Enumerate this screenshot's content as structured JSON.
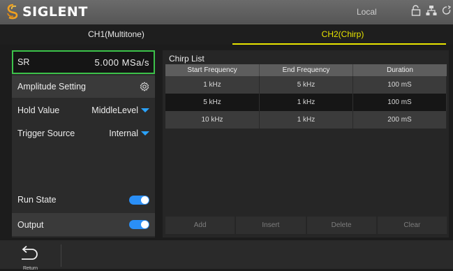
{
  "header": {
    "brand": "SIGLENT",
    "status_text": "Local",
    "icons": [
      "unlock-icon",
      "network-icon",
      "refresh-icon"
    ]
  },
  "tabs": [
    {
      "label": "CH1(Multitone)",
      "active": false
    },
    {
      "label": "CH2(Chirp)",
      "active": true
    }
  ],
  "settings": {
    "sr": {
      "label": "SR",
      "value": "5.000 MSa/s"
    },
    "amplitude": {
      "label": "Amplitude Setting"
    },
    "hold_value": {
      "label": "Hold Value",
      "value": "MiddleLevel"
    },
    "trigger_source": {
      "label": "Trigger Source",
      "value": "Internal"
    },
    "run_state": {
      "label": "Run State",
      "on": true
    },
    "output": {
      "label": "Output",
      "on": true
    }
  },
  "chirp_list": {
    "title": "Chirp List",
    "columns": [
      "Start Frequency",
      "End Frequency",
      "Duration"
    ],
    "rows": [
      [
        "1 kHz",
        "5 kHz",
        "100 mS"
      ],
      [
        "5 kHz",
        "1 kHz",
        "100 mS"
      ],
      [
        "10 kHz",
        "1 kHz",
        "200 mS"
      ]
    ]
  },
  "actions": [
    "Add",
    "Insert",
    "Delete",
    "Clear"
  ],
  "footer": {
    "return_label": "Return"
  },
  "colors": {
    "accent_active_tab": "#e8e400",
    "sr_border": "#3cc24a",
    "toggle_on": "#2a8ff7",
    "dropdown_arrow": "#2aa3ff"
  }
}
